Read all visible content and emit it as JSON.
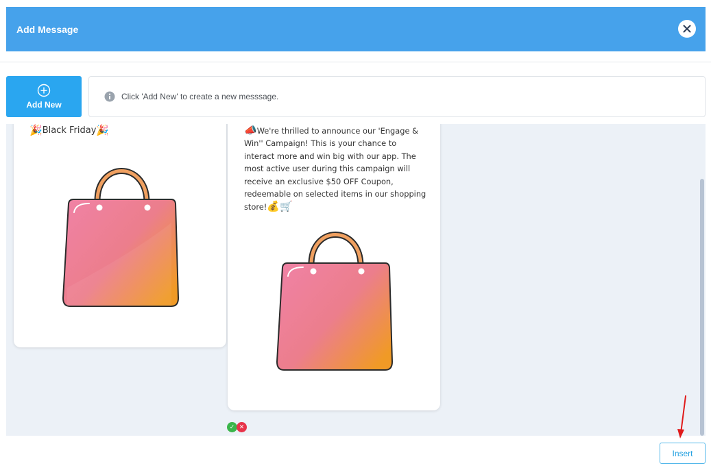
{
  "dialog": {
    "title": "Add Message",
    "close_icon": "close-icon"
  },
  "toolbar": {
    "add_new_label": "Add New",
    "add_new_icon": "plus-circle-icon",
    "info_icon": "info-icon",
    "info_text": "Click 'Add New' to create a new messsage."
  },
  "messages": [
    {
      "title": "Black Friday",
      "emojis": [
        "party-popper",
        "party-popper"
      ],
      "image": "shopping-bag-image"
    },
    {
      "text_prefix_emoji": "megaphone",
      "text": "We're thrilled to announce our 'Engage & Win'' Campaign! This is your chance to interact more and win big with our app. The most active user during this campaign will receive an exclusive $50 OFF Coupon, redeemable on selected items in our shopping store!",
      "text_suffix_emojis": [
        "money-bag",
        "shopping-cart"
      ],
      "image": "shopping-bag-image",
      "status_icons": [
        "check-circle-icon",
        "x-circle-icon"
      ]
    }
  ],
  "footer": {
    "insert_label": "Insert"
  },
  "colors": {
    "header": "#46a2eb",
    "add_new_button": "#2aa6f0",
    "content_background": "#ecf1f7",
    "insert_border": "#55b8ea",
    "annotation_arrow": "#e01b1b"
  }
}
